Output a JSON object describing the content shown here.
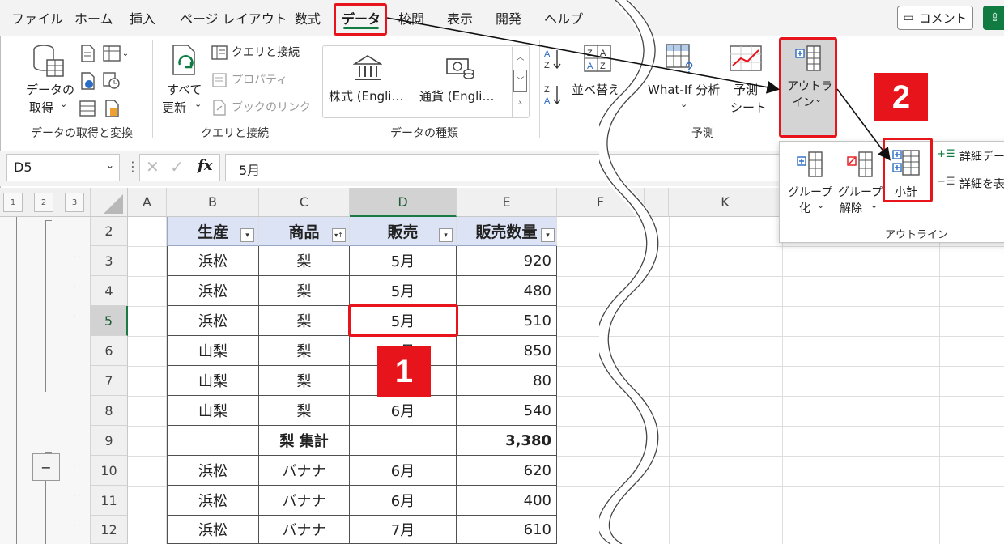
{
  "tabs": [
    "ファイル",
    "ホーム",
    "挿入",
    "ページ レイアウト",
    "数式",
    "データ",
    "校閲",
    "表示",
    "開発",
    "ヘルプ"
  ],
  "header_buttons": {
    "comment": "コメント"
  },
  "ribbon": {
    "get_data": {
      "label1": "データの",
      "label2": "取得",
      "group": "データの取得と変換"
    },
    "queries": {
      "refresh1": "すべて",
      "refresh2": "更新",
      "queries_connections": "クエリと接続",
      "properties": "プロパティ",
      "workbook_links": "ブックのリンク",
      "group": "クエリと接続"
    },
    "data_types": {
      "stocks": "株式 (Engli…",
      "currency": "通貨 (Engli…",
      "group": "データの種類"
    },
    "sort": {
      "sort_label": "並べ替え"
    },
    "forecast": {
      "whatif": "What-If 分析",
      "sheet1": "予測",
      "sheet2": "シート",
      "group": "予測"
    },
    "outline": {
      "label1": "アウトラ",
      "label2": "イン"
    }
  },
  "outline_panel": {
    "group_label1": "グループ",
    "group_label2": "化",
    "ungroup_label1": "グループ",
    "ungroup_label2": "解除",
    "subtotal": "小計",
    "show_detail": "詳細デー",
    "hide_detail": "詳細を表",
    "title": "アウトライン"
  },
  "formula_bar": {
    "name_box": "D5",
    "fx": "fx",
    "formula": "5月"
  },
  "columns": [
    "A",
    "B",
    "C",
    "D",
    "E",
    "F",
    "K"
  ],
  "outline_levels": [
    "1",
    "2",
    "3"
  ],
  "collapse_button": "−",
  "table": {
    "headers": [
      "生産",
      "商品",
      "販売",
      "販売数量"
    ],
    "rows": [
      {
        "row": "2",
        "cells": []
      },
      {
        "row": "3",
        "cells": [
          "浜松",
          "梨",
          "5月",
          "920"
        ]
      },
      {
        "row": "4",
        "cells": [
          "浜松",
          "梨",
          "5月",
          "480"
        ]
      },
      {
        "row": "5",
        "cells": [
          "浜松",
          "梨",
          "5月",
          "510"
        ]
      },
      {
        "row": "6",
        "cells": [
          "山梨",
          "梨",
          "5月",
          "850"
        ]
      },
      {
        "row": "7",
        "cells": [
          "山梨",
          "梨",
          "",
          "80"
        ]
      },
      {
        "row": "8",
        "cells": [
          "山梨",
          "梨",
          "6月",
          "540"
        ]
      },
      {
        "row": "9",
        "cells": [
          "",
          "梨 集計",
          "",
          "3,380"
        ]
      },
      {
        "row": "10",
        "cells": [
          "浜松",
          "バナナ",
          "6月",
          "620"
        ]
      },
      {
        "row": "11",
        "cells": [
          "浜松",
          "バナナ",
          "6月",
          "400"
        ]
      },
      {
        "row": "12",
        "cells": [
          "浜松",
          "バナナ",
          "7月",
          "610"
        ]
      }
    ]
  },
  "badges": [
    "1",
    "2"
  ],
  "colors": {
    "excel_green": "#107c41",
    "highlight_red": "#e8141b",
    "table_header": "#dbe3f4"
  }
}
